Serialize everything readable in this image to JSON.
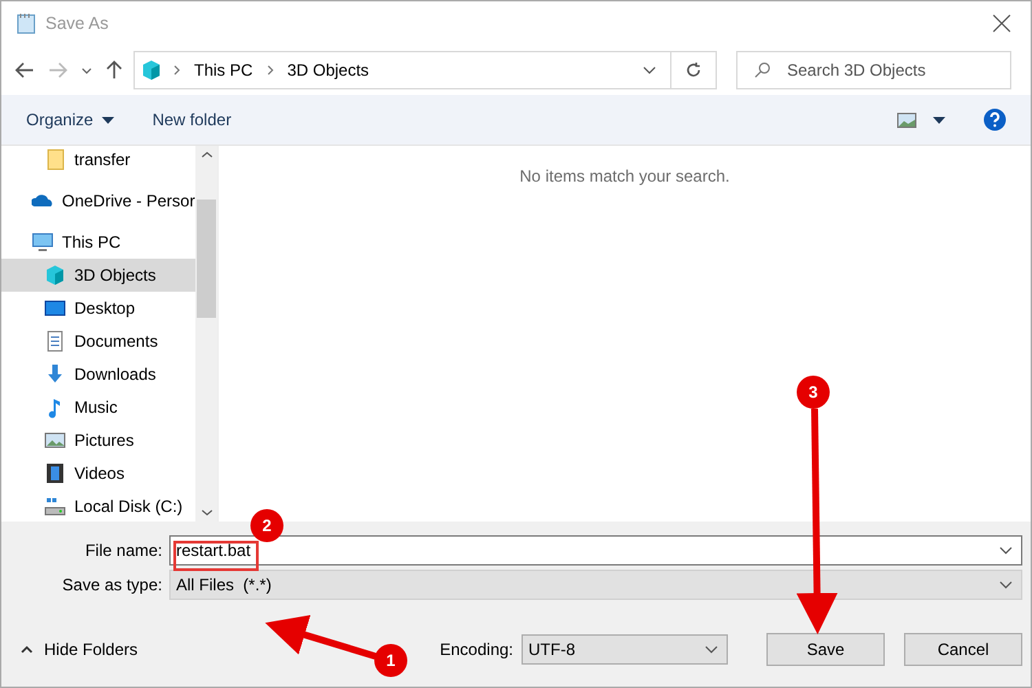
{
  "window": {
    "title": "Save As"
  },
  "address": {
    "path": [
      "This PC",
      "3D Objects"
    ]
  },
  "search": {
    "placeholder": "Search 3D Objects"
  },
  "toolbar": {
    "organize": "Organize",
    "new_folder": "New folder"
  },
  "tree": [
    {
      "children": [
        {
          "label": "transfer",
          "kind": "folder",
          "selected": false
        }
      ]
    },
    {
      "label": "OneDrive - Persor",
      "kind": "cloud",
      "selected": false
    },
    {
      "label": "This PC",
      "kind": "pc",
      "selected": false,
      "children": [
        {
          "label": "3D Objects",
          "kind": "cube",
          "selected": true
        },
        {
          "label": "Desktop",
          "kind": "desktop",
          "selected": false
        },
        {
          "label": "Documents",
          "kind": "documents",
          "selected": false
        },
        {
          "label": "Downloads",
          "kind": "downloads",
          "selected": false
        },
        {
          "label": "Music",
          "kind": "music",
          "selected": false
        },
        {
          "label": "Pictures",
          "kind": "pictures",
          "selected": false
        },
        {
          "label": "Videos",
          "kind": "videos",
          "selected": false
        },
        {
          "label": "Local Disk (C:)",
          "kind": "disk",
          "selected": false
        }
      ]
    }
  ],
  "empty_message": "No items match your search.",
  "file_name": {
    "label": "File name:",
    "value": "restart.bat"
  },
  "save_as_type": {
    "label": "Save as type:",
    "value": "All Files  (*.*)"
  },
  "hide_folders": "Hide Folders",
  "encoding": {
    "label": "Encoding:",
    "value": "UTF-8"
  },
  "buttons": [
    "Save",
    "Cancel"
  ],
  "annotations": [
    {
      "number": "1"
    },
    {
      "number": "2"
    },
    {
      "number": "3"
    }
  ]
}
